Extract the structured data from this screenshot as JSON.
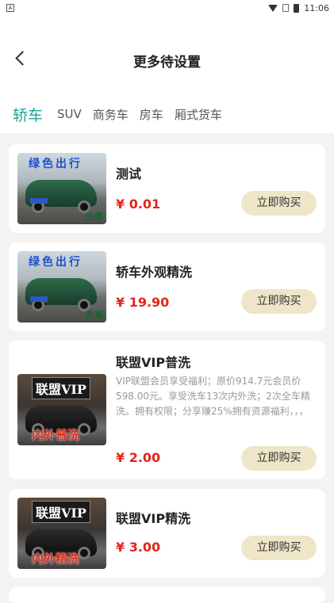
{
  "statusbar": {
    "time": "11:06",
    "app_icon_letter": "A"
  },
  "header": {
    "title": "更多待设置"
  },
  "tabs": [
    "轿车",
    "SUV",
    "商务车",
    "房车",
    "厢式货车"
  ],
  "products": [
    {
      "name": "测试",
      "price": "¥ 0.01",
      "buy_label": "立即购买",
      "thumb_top": "绿色出行",
      "thumb_bottom": "外观"
    },
    {
      "name": "轿车外观精洗",
      "price": "¥ 19.90",
      "buy_label": "立即购买",
      "thumb_top": "绿色出行",
      "thumb_bottom": "外观"
    },
    {
      "name": "联盟VIP普洗",
      "desc": "VIP联盟会员享受福利；原价914.7元会员价598.00元。享受洗车13次内外洗；2次全车精洗。拥有权限；分享赚25%拥有资源福利，，，",
      "price": "¥ 2.00",
      "buy_label": "立即购买",
      "thumb_top": "联盟VIP",
      "thumb_bottom": "内外普洗"
    },
    {
      "name": "联盟VIP精洗",
      "price": "¥ 3.00",
      "buy_label": "立即购买",
      "thumb_top": "联盟VIP",
      "thumb_bottom": "内外精洗"
    }
  ],
  "colors": {
    "accent": "#21a597",
    "price": "#e2261b",
    "button_bg": "#efe5c8"
  }
}
